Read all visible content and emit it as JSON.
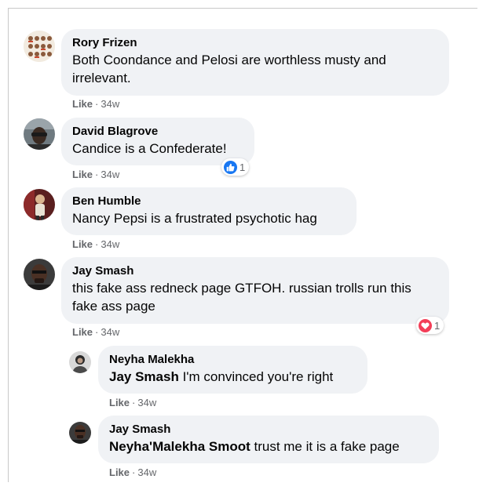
{
  "comments": [
    {
      "author": "Rory Frizen",
      "text": "Both Coondance and Pelosi are worthless musty and irrelevant.",
      "like_label": "Like",
      "dot": "·",
      "time": "34w"
    },
    {
      "author": "David Blagrove",
      "text": "Candice is a Confederate!",
      "like_label": "Like",
      "dot": "·",
      "time": "34w",
      "reaction": {
        "icon": "thumbs-up-icon",
        "count": "1"
      }
    },
    {
      "author": "Ben Humble",
      "text": "Nancy Pepsi is a frustrated psychotic hag",
      "like_label": "Like",
      "dot": "·",
      "time": "34w"
    },
    {
      "author": "Jay Smash",
      "text": "this fake ass redneck page GTFOH. russian trolls run this fake ass page",
      "like_label": "Like",
      "dot": "·",
      "time": "34w",
      "reaction": {
        "icon": "heart-icon",
        "count": "1"
      }
    }
  ],
  "replies": [
    {
      "author": "Neyha Malekha",
      "mention": "Jay Smash",
      "text": " I'm convinced you're right",
      "like_label": "Like",
      "dot": "·",
      "time": "34w"
    },
    {
      "author": "Jay Smash",
      "mention": "Neyha'Malekha Smoot",
      "text": " trust me it is a fake page",
      "like_label": "Like",
      "dot": "·",
      "time": "34w"
    }
  ],
  "colors": {
    "bubble": "#f0f2f5",
    "meta_text": "#65676b",
    "like_blue": "#1877f2",
    "love_red": "#f33e58"
  }
}
